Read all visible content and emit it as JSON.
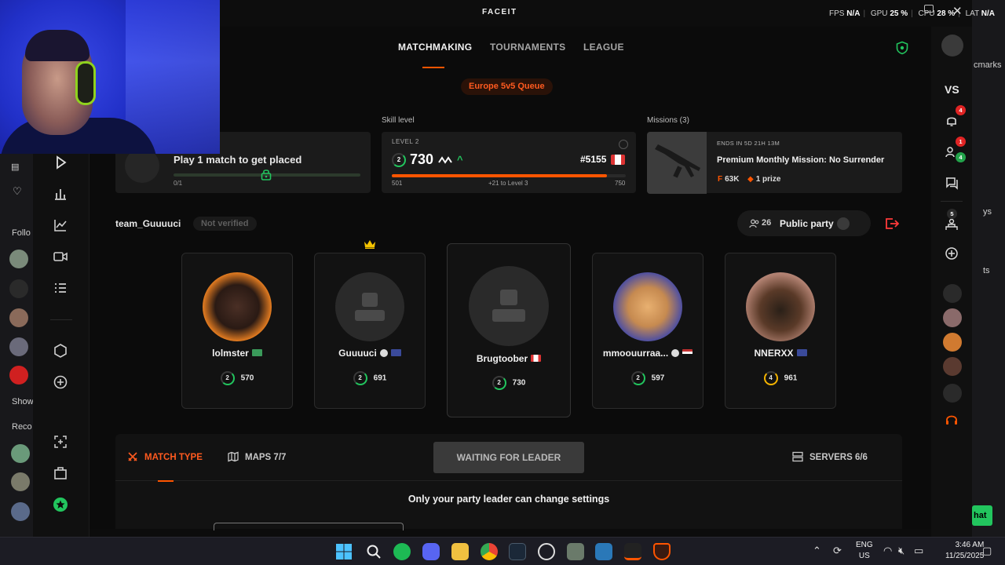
{
  "titlebar": {
    "logo": "FACEIT",
    "fps_label": "FPS",
    "fps_value": "N/A",
    "gpu_label": "GPU",
    "gpu_value": "25 %",
    "cpu_label": "CPU",
    "cpu_value": "28 %",
    "lat_label": "LAT",
    "lat_value": "N/A"
  },
  "nav": {
    "tabs": [
      {
        "label": "MATCHMAKING",
        "active": true
      },
      {
        "label": "TOURNAMENTS",
        "active": false
      },
      {
        "label": "LEAGUE",
        "active": false
      }
    ]
  },
  "queue": {
    "label": "Europe 5v5 Queue"
  },
  "placement": {
    "title": "Play 1 match to get placed",
    "progress_text": "0/1"
  },
  "skill": {
    "section_label": "Skill level",
    "level_label": "LEVEL 2",
    "level": "2",
    "elo": "730",
    "rank": "#5155",
    "bar_min": "501",
    "bar_max": "750",
    "bar_mid": "+21 to Level 3",
    "bar_progress": 0.92
  },
  "missions": {
    "section_label": "Missions (3)",
    "ends": "ENDS IN 5D 21H 13M",
    "title": "Premium Monthly Mission: No Surrender",
    "reward_points": "63K",
    "reward_prize": "1 prize"
  },
  "party": {
    "team_name": "team_Guuuuci",
    "verified_status": "Not verified",
    "count": "26",
    "visibility_label": "Public party"
  },
  "players": [
    {
      "name": "lolmster",
      "level": "2",
      "elo": "570",
      "flag": "#3a9a5a"
    },
    {
      "name": "Guuuuci",
      "level": "2",
      "elo": "691",
      "flag": "#3a4a9a",
      "leader": true
    },
    {
      "name": "Brugtoober",
      "level": "2",
      "elo": "730",
      "flag": "#d33333"
    },
    {
      "name": "mmoouurraa...",
      "level": "2",
      "elo": "597",
      "flag": "#c03030"
    },
    {
      "name": "NNERXX",
      "level": "4",
      "elo": "961",
      "flag": "#3a4a9a"
    }
  ],
  "settings": {
    "match_type_label": "MATCH TYPE",
    "maps_label": "MAPS 7/7",
    "waiting_label": "WAITING FOR LEADER",
    "servers_label": "SERVERS 6/6",
    "message": "Only your party leader can change settings"
  },
  "rightrail": {
    "vs_label": "VS",
    "notif_badge": "4",
    "friends_badge_red": "1",
    "friends_badge_green": "4",
    "party_badge": "5"
  },
  "browser_bg": {
    "left_follow": "Follo",
    "left_show": "Show",
    "left_reco": "Reco",
    "right_marks": "cmarks",
    "right_ys": "ys",
    "right_ts": "ts",
    "right_chat": "hat"
  },
  "taskbar": {
    "lang_top": "ENG",
    "lang_bottom": "US",
    "time": "3:46 AM",
    "date": "11/25/2025"
  },
  "colors": {
    "accent": "#ff5500",
    "green": "#22c55e",
    "danger": "#ff3a3a"
  }
}
